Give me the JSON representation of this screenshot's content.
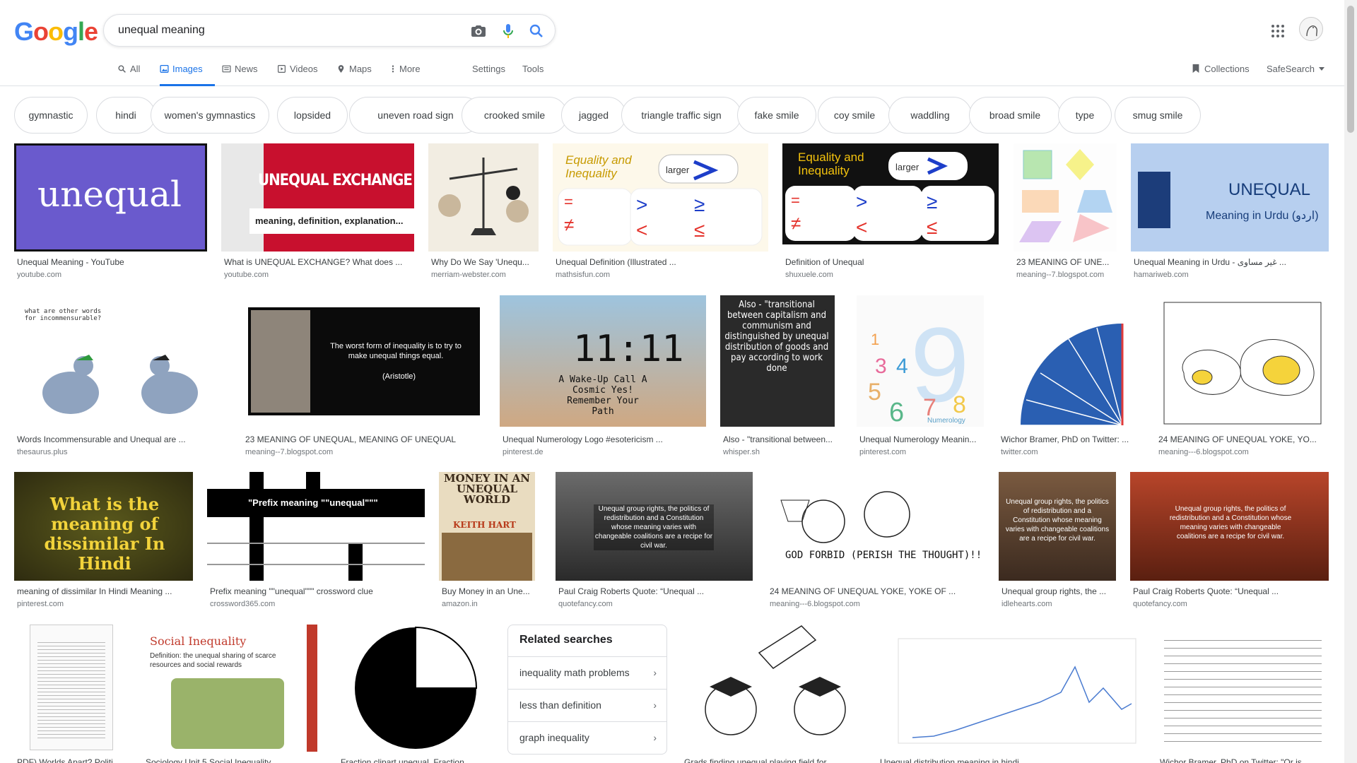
{
  "search": {
    "query": "unequal meaning"
  },
  "logo": {
    "letters": [
      "G",
      "o",
      "o",
      "g",
      "l",
      "e"
    ],
    "colors": [
      "#4285f4",
      "#ea4335",
      "#fbbc05",
      "#4285f4",
      "#34a853",
      "#ea4335"
    ]
  },
  "nav": {
    "tabs": [
      {
        "label": "All",
        "icon": "search-icon"
      },
      {
        "label": "Images",
        "icon": "image-icon",
        "active": true
      },
      {
        "label": "News",
        "icon": "news-icon"
      },
      {
        "label": "Videos",
        "icon": "video-icon"
      },
      {
        "label": "Maps",
        "icon": "map-pin-icon"
      },
      {
        "label": "More",
        "icon": "more-vert-icon"
      }
    ],
    "settings": "Settings",
    "tools": "Tools",
    "collections": "Collections",
    "safesearch": "SafeSearch"
  },
  "chips": [
    "gymnastic",
    "hindi",
    "women's gymnastics",
    "lopsided",
    "uneven road sign",
    "crooked smile",
    "jagged",
    "triangle traffic sign",
    "fake smile",
    "coy smile",
    "waddling",
    "broad smile",
    "type",
    "smug smile"
  ],
  "results": [
    {
      "caption": "Unequal Meaning - YouTube",
      "source": "youtube.com",
      "thumb_text": "unequal"
    },
    {
      "caption": "What is UNEQUAL EXCHANGE? What does ...",
      "source": "youtube.com",
      "thumb_text": "UNEQUAL EXCHANGE",
      "thumb_sub": "meaning, definition, explanation..."
    },
    {
      "caption": "Why Do We Say 'Unequ...",
      "source": "merriam-webster.com"
    },
    {
      "caption": "Unequal Definition (Illustrated ...",
      "source": "mathsisfun.com",
      "thumb_text": "Equality and Inequality"
    },
    {
      "caption": "Definition of Unequal",
      "source": "shuxuele.com",
      "thumb_text": "Equality and Inequality"
    },
    {
      "caption": "23 MEANING OF UNE...",
      "source": "meaning--7.blogspot.com"
    },
    {
      "caption": "Unequal Meaning in Urdu - غیر مساوی ...",
      "source": "hamariweb.com",
      "thumb_text": "UNEQUAL",
      "thumb_sub": "Meaning in Urdu (اردو)"
    },
    {
      "caption": "Words Incommensurable and Unequal are ...",
      "source": "thesaurus.plus",
      "thumb_text": "what are other words for incommensurable?"
    },
    {
      "caption": "23 MEANING OF UNEQUAL, MEANING OF UNEQUAL",
      "source": "meaning--7.blogspot.com",
      "thumb_text": "The worst form of inequality is to try to make unequal things equal.",
      "thumb_sub": "(Aristotle)"
    },
    {
      "caption": "Unequal Numerology Logo #esotericism ...",
      "source": "pinterest.de",
      "thumb_text": "11:11",
      "thumb_sub": "A Wake-Up Call A Cosmic Yes! Remember Your Path"
    },
    {
      "caption": "Also - \"transitional between...",
      "source": "whisper.sh",
      "thumb_text": "Also - \"transitional between capitalism and communism and distinguished by unequal distribution of goods and pay according to work done"
    },
    {
      "caption": "Unequal Numerology Meanin...",
      "source": "pinterest.com",
      "thumb_text": "Numerology"
    },
    {
      "caption": "Wichor Bramer, PhD on Twitter: ...",
      "source": "twitter.com"
    },
    {
      "caption": "24 MEANING OF UNEQUAL YOKE, YO...",
      "source": "meaning---6.blogspot.com"
    },
    {
      "caption": "meaning of dissimilar In Hindi Meaning ...",
      "source": "pinterest.com",
      "thumb_text": "What is the meaning of dissimilar In Hindi"
    },
    {
      "caption": "Prefix meaning \"\"unequal\"\"\" crossword clue",
      "source": "crossword365.com",
      "thumb_text": "\"Prefix meaning \"\"unequal\"\"\""
    },
    {
      "caption": "Buy Money in an Une...",
      "source": "amazon.in",
      "thumb_text": "MONEY IN AN UNEQUAL WORLD",
      "thumb_sub": "KEITH HART"
    },
    {
      "caption": "Paul Craig Roberts Quote: “Unequal ...",
      "source": "quotefancy.com",
      "thumb_text": "Unequal group rights, the politics of redistribution and a Constitution whose meaning varies with changeable coalitions are a recipe for civil war."
    },
    {
      "caption": "24 MEANING OF UNEQUAL YOKE, YOKE OF ...",
      "source": "meaning---6.blogspot.com",
      "thumb_text": "GOD FORBID (PERISH THE THOUGHT)!!"
    },
    {
      "caption": "Unequal group rights, the ...",
      "source": "idlehearts.com",
      "thumb_text": "Unequal group rights, the politics of redistribution and a Constitution whose meaning varies with changeable coalitions are a recipe for civil war."
    },
    {
      "caption": "Paul Craig Roberts Quote: “Unequal ...",
      "source": "quotefancy.com",
      "thumb_text": "Unequal group rights, the politics of redistribution and a Constitution whose meaning varies with changeable coalitions are a recipe for civil war."
    },
    {
      "caption": "PDF) Worlds Apart? Politi...",
      "source": ""
    },
    {
      "caption": "Sociology Unit 5 Social Inequality",
      "source": "",
      "thumb_text": "Social Inequality",
      "thumb_sub": "Definition: the unequal sharing of scarce resources and social rewards"
    },
    {
      "caption": "Fraction clipart unequal. Fraction ...",
      "source": ""
    },
    {
      "caption": "Grads finding unequal playing field for ...",
      "source": ""
    },
    {
      "caption": "Unequal distribution meaning in hindi ...",
      "source": ""
    },
    {
      "caption": "Wichor Bramer, PhD on Twitter: \"Or is ...",
      "source": ""
    }
  ],
  "related": {
    "title": "Related searches",
    "items": [
      "inequality math problems",
      "less than definition",
      "graph inequality"
    ]
  }
}
